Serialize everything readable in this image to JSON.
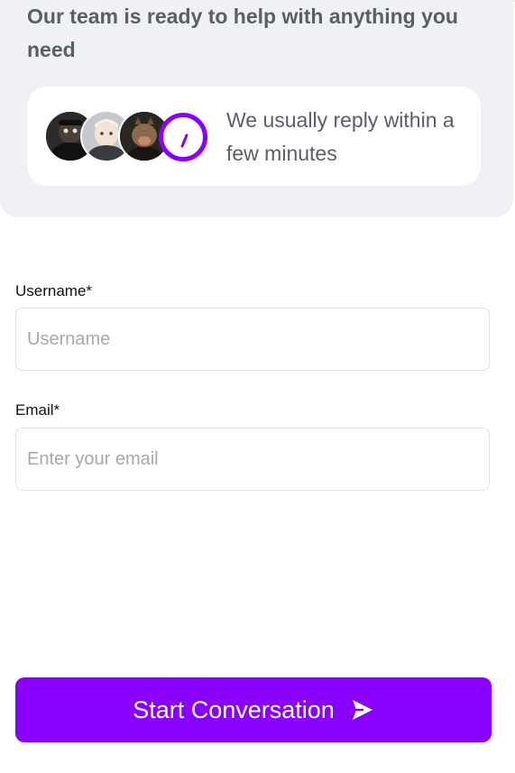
{
  "header": {
    "tagline": "Our team is ready to help with anything you need",
    "reply_time": "We usually reply within a few minutes",
    "avatars": [
      {
        "icon": "team-member-avatar"
      },
      {
        "icon": "team-member-avatar"
      },
      {
        "icon": "team-member-avatar"
      }
    ],
    "clock_icon": "clock-icon"
  },
  "form": {
    "username": {
      "label": "Username*",
      "placeholder": "Username",
      "value": ""
    },
    "email": {
      "label": "Email*",
      "placeholder": "Enter your email",
      "value": ""
    }
  },
  "actions": {
    "start_label": "Start Conversation",
    "start_icon": "send-icon"
  },
  "colors": {
    "accent": "#8a00ff",
    "panel": "#f0f1f4",
    "text_muted": "#5b5e66"
  }
}
